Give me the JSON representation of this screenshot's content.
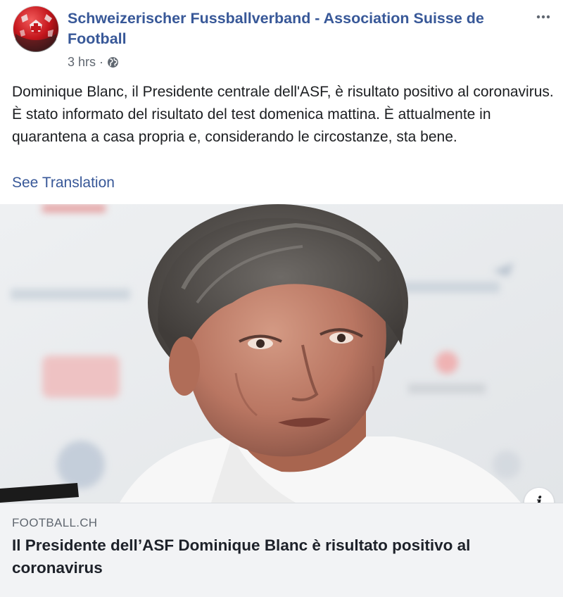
{
  "post": {
    "page_name": "Schweizerischer Fussballverband - Association Suisse de Football",
    "timestamp": "3 hrs",
    "separator": "·",
    "privacy_icon": "globe-icon",
    "text": "Dominique Blanc, il Presidente centrale dell'ASF, è risultato positivo al coronavirus. È stato informato del risultato del test domenica mattina. È attualmente in quarantena a casa propria e, considerando le circostanze, sta bene.",
    "see_translation": "See Translation",
    "more_icon": "more-options-icon"
  },
  "link_preview": {
    "domain": "FOOTBALL.CH",
    "title": "Il Presidente dell’ASF Dominique Blanc è risultato positivo al coronavirus",
    "info_label": "i"
  },
  "colors": {
    "link_blue": "#385898",
    "secondary_text": "#606770",
    "caption_bg": "#f2f3f5"
  }
}
